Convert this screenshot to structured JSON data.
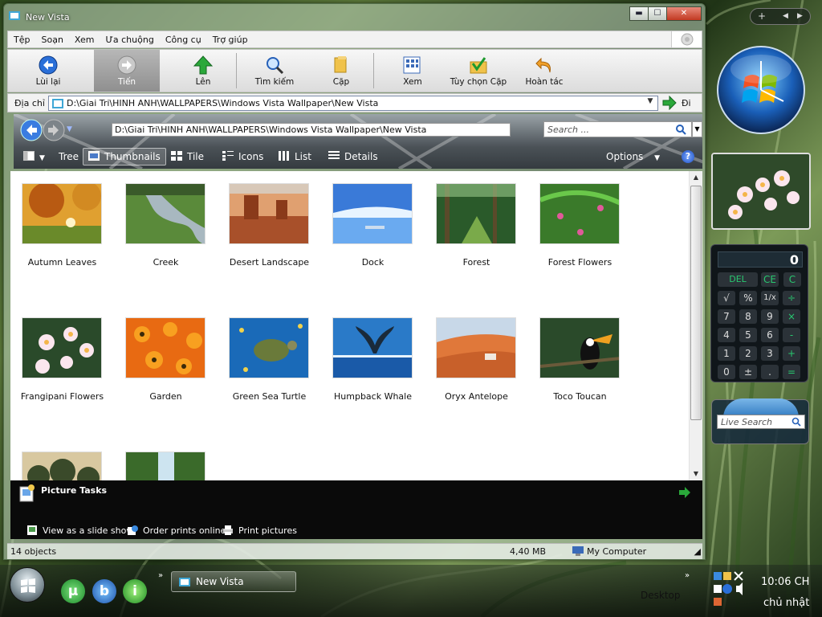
{
  "window": {
    "title": "New Vista",
    "controls": {
      "minimize": "▬",
      "maximize": "☐",
      "close": "✕"
    }
  },
  "menu": [
    "Tệp",
    "Soạn",
    "Xem",
    "Ưa chuộng",
    "Công cụ",
    "Trợ giúp"
  ],
  "toolbar": {
    "back": "Lùi lại",
    "forward": "Tiến",
    "up": "Lên",
    "search": "Tìm kiếm",
    "folders": "Cặp",
    "views": "Xem",
    "folder_options": "Tùy chọn Cặp",
    "undo": "Hoàn tác"
  },
  "address": {
    "label": "Địa chỉ",
    "value": "D:\\Giai Tri\\HINH ANH\\WALLPAPERS\\Windows Vista Wallpaper\\New Vista",
    "go_label": "Đi"
  },
  "browser": {
    "path": "D:\\Giai Tri\\HINH ANH\\WALLPAPERS\\Windows Vista Wallpaper\\New Vista",
    "search_placeholder": "Search ...",
    "views": {
      "tree": "Tree",
      "thumbnails": "Thumbnails",
      "tile": "Tile",
      "icons": "Icons",
      "list": "List",
      "details": "Details"
    },
    "options": "Options",
    "help": "?"
  },
  "files": [
    {
      "name": "Autumn Leaves",
      "theme": "autumn"
    },
    {
      "name": "Creek",
      "theme": "creek"
    },
    {
      "name": "Desert Landscape",
      "theme": "desert"
    },
    {
      "name": "Dock",
      "theme": "dock"
    },
    {
      "name": "Forest",
      "theme": "forest"
    },
    {
      "name": "Forest Flowers",
      "theme": "flowers"
    },
    {
      "name": "Frangipani Flowers",
      "theme": "frangipani"
    },
    {
      "name": "Garden",
      "theme": "garden"
    },
    {
      "name": "Green Sea Turtle",
      "theme": "turtle"
    },
    {
      "name": "Humpback Whale",
      "theme": "whale"
    },
    {
      "name": "Oryx Antelope",
      "theme": "oryx"
    },
    {
      "name": "Toco Toucan",
      "theme": "toucan"
    },
    {
      "name": "",
      "theme": "trees"
    },
    {
      "name": "",
      "theme": "waterfall"
    }
  ],
  "tasks": {
    "title": "Picture Tasks",
    "links": [
      "View as a slide show",
      "Order prints online",
      "Print pictures"
    ]
  },
  "status": {
    "objects": "14 objects",
    "size": "4,40 MB",
    "zone": "My Computer"
  },
  "sidebar": {
    "controls": [
      "+",
      "◀",
      "▶"
    ],
    "calculator": {
      "display": "0",
      "keys": [
        [
          "DEL",
          "CE",
          "C"
        ],
        [
          "√",
          "%",
          "1/x",
          "÷"
        ],
        [
          "7",
          "8",
          "9",
          "×"
        ],
        [
          "4",
          "5",
          "6",
          "-"
        ],
        [
          "1",
          "2",
          "3",
          "+"
        ],
        [
          "0",
          "±",
          ".",
          "="
        ]
      ]
    },
    "live_search_placeholder": "Live Search"
  },
  "taskbar": {
    "window_button": "New Vista",
    "desktop_label": "Desktop",
    "time": "10:06 CH",
    "day": "chủ nhật",
    "quick_launch": [
      "µ",
      "b",
      "i"
    ]
  },
  "colors": {
    "accent_green": "#2aa83a",
    "selection_blue": "#1d4fc4",
    "tasks_bg": "#0a0a0a"
  }
}
